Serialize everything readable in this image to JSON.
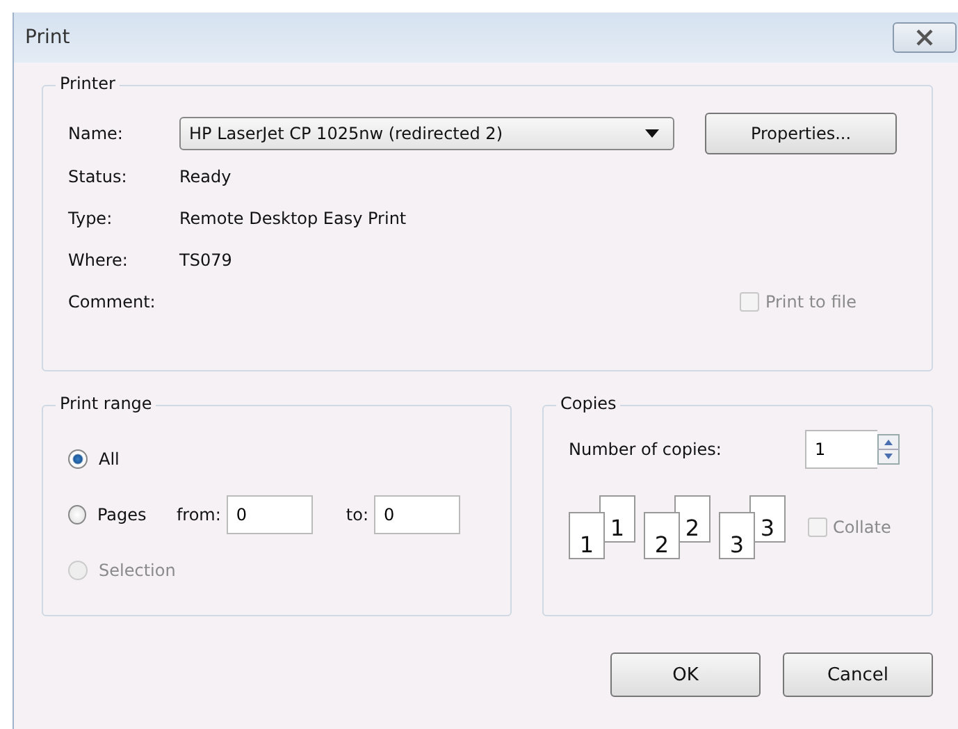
{
  "window": {
    "title": "Print"
  },
  "printer": {
    "title": "Printer",
    "name_label": "Name:",
    "name_value": "HP LaserJet CP 1025nw (redirected 2)",
    "properties_button": "Properties...",
    "info": [
      {
        "label": "Status:",
        "value": "Ready"
      },
      {
        "label": "Type:",
        "value": "Remote Desktop Easy Print"
      },
      {
        "label": "Where:",
        "value": "TS079"
      },
      {
        "label": "Comment:"
      }
    ],
    "print_to_file": {
      "label": "Print to file",
      "checked": false,
      "disabled": true
    }
  },
  "print_range": {
    "title": "Print range",
    "options": [
      {
        "label": "All",
        "selected": true,
        "disabled": false
      },
      {
        "label": "Pages",
        "selected": false,
        "disabled": false,
        "fields": [
          {
            "label": "from:",
            "value": "0"
          },
          {
            "label": "to:",
            "value": "0"
          }
        ]
      },
      {
        "label": "Selection",
        "selected": false,
        "disabled": true
      }
    ]
  },
  "copies": {
    "title": "Copies",
    "number_label": "Number of copies:",
    "number_value": "1",
    "collate_pages": [
      {
        "front": "1",
        "back": "1"
      },
      {
        "front": "2",
        "back": "2"
      },
      {
        "front": "3",
        "back": "3"
      }
    ],
    "collate": {
      "label": "Collate",
      "checked": false,
      "disabled": true
    }
  },
  "buttons": [
    {
      "label": "OK"
    },
    {
      "label": "Cancel"
    }
  ]
}
